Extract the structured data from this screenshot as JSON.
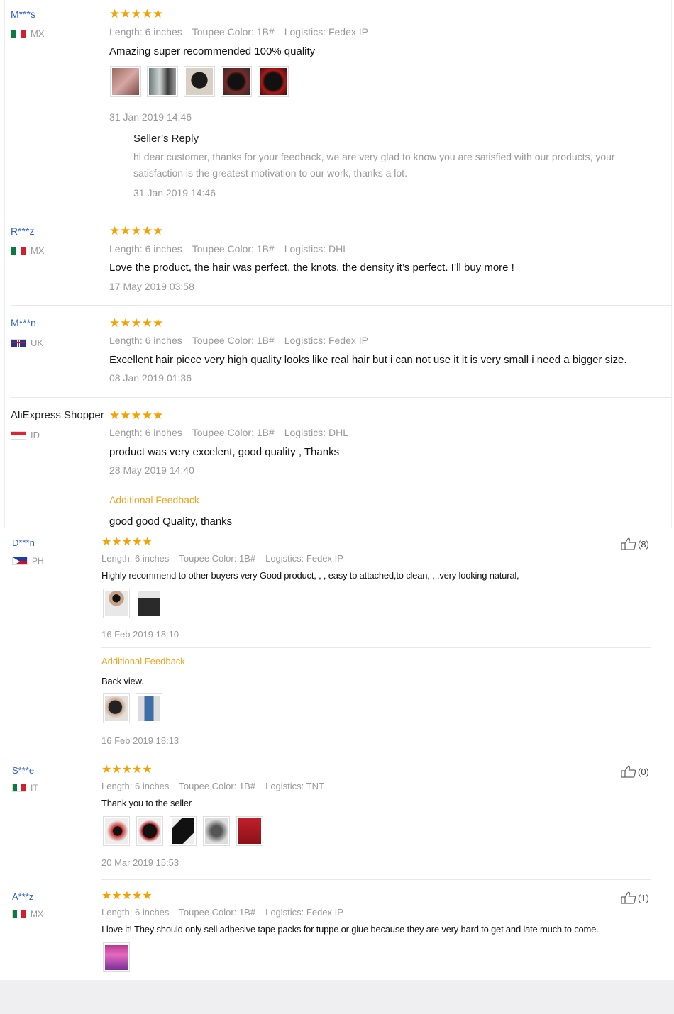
{
  "colors": {
    "username": "#2f63c7",
    "star": "#f5a100",
    "muted": "#999999",
    "additional": "#f0a31c"
  },
  "reviews": [
    {
      "user": "M***s",
      "country": "MX",
      "stars": "★★★★★",
      "length": "Length: 6 inches",
      "color": "Toupee Color: 1B#",
      "logistics": "Logistics: Fedex IP",
      "text": "Amazing super recommended 100% quality",
      "date": "31 Jan 2019 14:46",
      "reply_title": "Seller’s Reply",
      "reply_text": "hi dear customer, thanks for your feedback, we are very glad to know you are satisfied with our products, your satisfaction is the greatest motivation to our work, thanks a lot.",
      "reply_date": "31 Jan 2019 14:46"
    },
    {
      "user": "R***z",
      "country": "MX",
      "stars": "★★★★★",
      "length": "Length: 6 inches",
      "color": "Toupee Color: 1B#",
      "logistics": "Logistics: DHL",
      "text": "Love the product, the hair was perfect, the knots, the density it’s perfect. I’ll buy more !",
      "date": "17 May 2019 03:58"
    },
    {
      "user": "M***n",
      "country": "UK",
      "stars": "★★★★★",
      "length": "Length: 6 inches",
      "color": "Toupee Color: 1B#",
      "logistics": "Logistics: Fedex IP",
      "text": "Excellent hair piece very high quality looks like real hair but i can not use it it is very small i need a bigger size.",
      "date": "08 Jan 2019 01:36"
    },
    {
      "user": "AliExpress Shopper",
      "country": "ID",
      "stars": "★★★★★",
      "length": "Length: 6 inches",
      "color": "Toupee Color: 1B#",
      "logistics": "Logistics: DHL",
      "text": "product was very excelent, good quality , Thanks",
      "date": "28 May 2019 14:40",
      "additional_label": "Additional Feedback",
      "additional_text": "good good Quality, thanks"
    },
    {
      "user": "D***n",
      "country": "PH",
      "stars": "★★★★★",
      "length": "Length: 6 inches",
      "color": "Toupee Color: 1B#",
      "logistics": "Logistics: Fedex IP",
      "text": "Highly recommend to other buyers very Good product, , , easy to attached,to clean, , ,very looking natural,",
      "date": "16 Feb 2019 18:10",
      "likes": "(8)",
      "additional_label": "Additional Feedback",
      "additional_text": "Back view.",
      "additional_date": "16 Feb 2019 18:13"
    },
    {
      "user": "S***e",
      "country": "IT",
      "stars": "★★★★★",
      "length": "Length: 6 inches",
      "color": "Toupee Color: 1B#",
      "logistics": "Logistics: TNT",
      "text": "Thank you to the seller",
      "date": "20 Mar 2019 15:53",
      "likes": "(0)"
    },
    {
      "user": "A***z",
      "country": "MX",
      "stars": "★★★★★",
      "length": "Length: 6 inches",
      "color": "Toupee Color: 1B#",
      "logistics": "Logistics: Fedex IP",
      "text": "I love it! They should only sell adhesive tape packs for tuppe or glue because they are very hard to get and late much to come.",
      "likes": "(1)"
    }
  ]
}
